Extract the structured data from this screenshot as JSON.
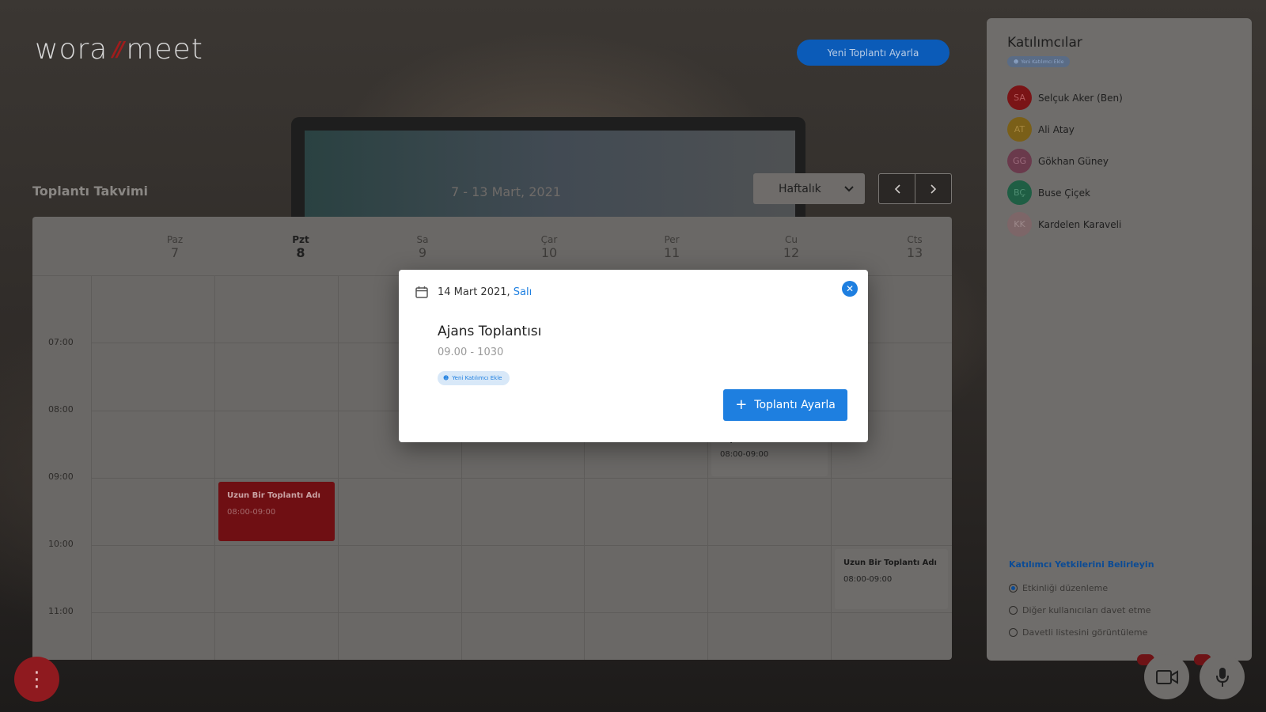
{
  "app": {
    "logo_left": "wora",
    "logo_right": "meet",
    "new_meeting_button": "Yeni Toplantı Ayarla"
  },
  "calendar": {
    "title": "Toplantı Takvimi",
    "range": "7 - 13 Mart, 2021",
    "view": "Haftalık",
    "days": [
      {
        "name": "Paz",
        "date": "7"
      },
      {
        "name": "Pzt",
        "date": "8"
      },
      {
        "name": "Sa",
        "date": "9"
      },
      {
        "name": "Çar",
        "date": "10"
      },
      {
        "name": "Per",
        "date": "11"
      },
      {
        "name": "Cu",
        "date": "12"
      },
      {
        "name": "Cts",
        "date": "13"
      }
    ],
    "times": [
      "07:00",
      "08:00",
      "09:00",
      "10:00",
      "11:00"
    ],
    "events": [
      {
        "title": "Uzun Bir Toplantı Adı",
        "time": "08:00-09:00"
      },
      {
        "title": "Toplantı Adı",
        "time": "08:00-09:00"
      },
      {
        "title": "Uzun Bir Toplantı Adı",
        "time": "08:00-09:00"
      }
    ]
  },
  "participants": {
    "title": "Katılımcılar",
    "add_chip": "Yeni Katılımcı Ekle",
    "people": [
      {
        "initials": "SA",
        "name": "Selçuk Aker (Ben)",
        "color": "#7a1416"
      },
      {
        "initials": "AT",
        "name": "Ali Atay",
        "color": "#7a5f18"
      },
      {
        "initials": "GG",
        "name": "Gökhan Güney",
        "color": "#6a3a4c"
      },
      {
        "initials": "BÇ",
        "name": "Buse Çiçek",
        "color": "#1f5e44"
      },
      {
        "initials": "KK",
        "name": "Kardelen Karaveli",
        "color": "#7d6668"
      }
    ],
    "permissions_title": "Katılımcı Yetkilerini Belirleyin",
    "permissions": [
      {
        "label": "Etkinliği düzenleme",
        "checked": true
      },
      {
        "label": "Diğer kullanıcıları davet etme",
        "checked": false
      },
      {
        "label": "Davetli listesini görüntüleme",
        "checked": false
      }
    ]
  },
  "modal": {
    "date": "14 Mart 2021,",
    "day": "Salı",
    "title": "Ajans Toplantısı",
    "time": "09.00 - 1030",
    "add_participant": "Yeni Katılımcı Ekle",
    "primary_button": "Toplantı Ayarla"
  },
  "colors": {
    "accent": "#1e7fe0",
    "brand_red": "#8f1a1f"
  }
}
